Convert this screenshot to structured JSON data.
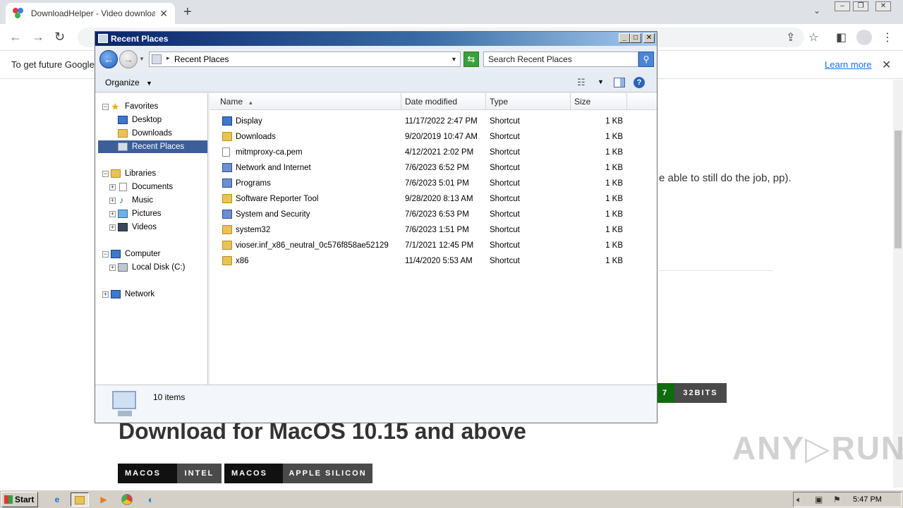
{
  "browser": {
    "tab_title": "DownloadHelper - Video download bro",
    "tab_close": "✕",
    "new_tab": "+",
    "infobar_message": "To get future Google",
    "learn_more": "Learn more",
    "infobar_close": "✕"
  },
  "webpage": {
    "paragraph": "e able to still do the job, pp).",
    "btn_7": "7",
    "btn_32bits": "32BITS",
    "mac_heading": "Download for MacOS 10.15 and above",
    "mac_btn1_os": "MACOS",
    "mac_btn1_arch": "INTEL",
    "mac_btn2_os": "MACOS",
    "mac_btn2_arch": "APPLE SILICON",
    "watermark": "ANY▷RUN"
  },
  "explorer": {
    "title": "Recent Places",
    "address": "Recent Places",
    "search_placeholder": "Search Recent Places",
    "organize": "Organize",
    "nav": {
      "favorites": "Favorites",
      "desktop": "Desktop",
      "downloads": "Downloads",
      "recent_places": "Recent Places",
      "libraries": "Libraries",
      "documents": "Documents",
      "music": "Music",
      "pictures": "Pictures",
      "videos": "Videos",
      "computer": "Computer",
      "local_disk": "Local Disk (C:)",
      "network": "Network"
    },
    "columns": {
      "name": "Name",
      "date": "Date modified",
      "type": "Type",
      "size": "Size"
    },
    "files": [
      {
        "name": "Display",
        "date": "11/17/2022 2:47 PM",
        "type": "Shortcut",
        "size": "1 KB",
        "icon": "monitor"
      },
      {
        "name": "Downloads",
        "date": "9/20/2019 10:47 AM",
        "type": "Shortcut",
        "size": "1 KB",
        "icon": "folder"
      },
      {
        "name": "mitmproxy-ca.pem",
        "date": "4/12/2021 2:02 PM",
        "type": "Shortcut",
        "size": "1 KB",
        "icon": "file"
      },
      {
        "name": "Network and Internet",
        "date": "7/6/2023 6:52 PM",
        "type": "Shortcut",
        "size": "1 KB",
        "icon": "control-panel"
      },
      {
        "name": "Programs",
        "date": "7/6/2023 5:01 PM",
        "type": "Shortcut",
        "size": "1 KB",
        "icon": "control-panel"
      },
      {
        "name": "Software Reporter Tool",
        "date": "9/28/2020 8:13 AM",
        "type": "Shortcut",
        "size": "1 KB",
        "icon": "folder"
      },
      {
        "name": "System and Security",
        "date": "7/6/2023 6:53 PM",
        "type": "Shortcut",
        "size": "1 KB",
        "icon": "control-panel"
      },
      {
        "name": "system32",
        "date": "7/6/2023 1:51 PM",
        "type": "Shortcut",
        "size": "1 KB",
        "icon": "folder"
      },
      {
        "name": "vioser.inf_x86_neutral_0c576f858ae52129",
        "date": "7/1/2021 12:45 PM",
        "type": "Shortcut",
        "size": "1 KB",
        "icon": "folder"
      },
      {
        "name": "x86",
        "date": "11/4/2020 5:53 AM",
        "type": "Shortcut",
        "size": "1 KB",
        "icon": "folder"
      }
    ],
    "status": "10 items"
  },
  "taskbar": {
    "start": "Start",
    "clock": "5:47 PM"
  },
  "colors": {
    "titlebar": "#0a246a",
    "selection": "#3c5f9a",
    "link": "#1a73e8",
    "green_button": "#0e6b0e",
    "dark_button": "#4a4a4a"
  }
}
